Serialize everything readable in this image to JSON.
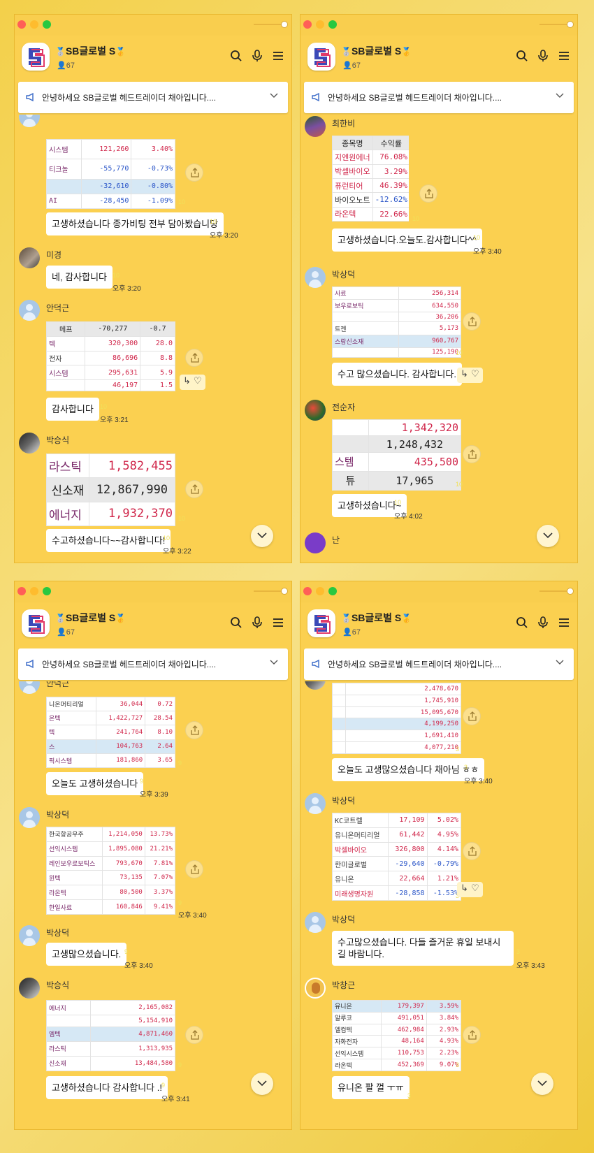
{
  "chat": {
    "title": "SB글로벌 S",
    "medal": "🥈",
    "medal2": "🥇",
    "members": "67",
    "notice": "안녕하세요 SB글로벌 헤드트레이더 채아입니다....",
    "react_reply": "↳",
    "react_heart": "♡"
  },
  "panels": [
    {
      "msgs": {
        "t1": [
          "시스템",
          "121,260",
          "3.40%",
          "티크놀",
          "-55,770",
          "-0.73%",
          "",
          "-32,610",
          "-0.80%",
          "AI",
          "-28,450",
          "-1.09%"
        ],
        "b1": "고생하셨습니다 종가비팅 전부 담아봤습니당",
        "c1": "10",
        "tm1": "오후 3:20",
        "ci1": "10",
        "n2": "미경",
        "b2": "네, 감사합니다",
        "c2": "10",
        "tm2": "오후 3:20",
        "n3": "안덕근",
        "t3": [
          "메프",
          "-70,277",
          "-0.7",
          "텍",
          "320,300",
          "28.0",
          "전자",
          "86,696",
          "8.8",
          "시스템",
          "295,631",
          "5.9",
          "",
          "46,197",
          "1.5"
        ],
        "b3": "감사합니다",
        "c3": "10",
        "tm3": "오후 3:21",
        "n4": "박승식",
        "t4": [
          "라스틱",
          "1,582,455",
          "신소재",
          "12,867,990",
          "에너지",
          "1,932,370"
        ],
        "ci4": "10",
        "b4": "수고하셨습니다~~감사합니다!",
        "c4": "10",
        "tm4": "오후 3:22"
      }
    },
    {
      "msgs": {
        "n1": "최한비",
        "t1h": [
          "종목명",
          "수익률"
        ],
        "t1": [
          "지엔원에너",
          "76.08%",
          "박셀바이오",
          "3.29%",
          "퓨런티어",
          "46.39%",
          "바이오노트",
          "-12.62%",
          "라온텍",
          "22.66%"
        ],
        "ci1": "10",
        "b1": "고생하셨습니다.오늘도.감사합니다^^",
        "c1": "10",
        "tm1": "오후 3:40",
        "n2": "박상덕",
        "t2": [
          "사료",
          "256,314",
          "보우로보틱",
          "634,550",
          "",
          "36,206",
          "트젠",
          "5,173",
          "스람신소재",
          "960,767",
          "",
          "125,190"
        ],
        "ci2": "10",
        "b2": "수고 많으셨습니다. 감사합니다.",
        "n3": "전순자",
        "t3": [
          "",
          "1,342,320",
          "",
          "1,248,432",
          "스템",
          "435,500",
          "튜",
          "17,965"
        ],
        "ci3": "10",
        "b3": "고생하셨습니다~",
        "c3": "10",
        "tm3": "오후 4:02",
        "n4": "난"
      }
    },
    {
      "msgs": {
        "n1": "안덕근",
        "t1": [
          "니온머티리얼",
          "36,044",
          "0.72",
          "온텍",
          "1,422,727",
          "28.54",
          "텍",
          "241,764",
          "8.10",
          "스",
          "104,763",
          "2.64",
          "픽시스템",
          "181,860",
          "3.65"
        ],
        "ci1": "9",
        "b1": "오늘도 고생하셨습니다",
        "c1": "9",
        "tm1": "오후 3:39",
        "n2": "박상덕",
        "t2": [
          "한국항공우주",
          "1,214,050",
          "13.73%",
          "선익시스템",
          "1,895,080",
          "21.21%",
          "레인보우로보틱스",
          "793,670",
          "7.81%",
          "윈텍",
          "73,135",
          "7.07%",
          "라온텍",
          "80,500",
          "3.37%",
          "한일사료",
          "160,846",
          "9.41%"
        ],
        "ci2": "9",
        "tm2": "오후 3:40",
        "n3": "박상덕",
        "b3": "고생많으셨습니다.",
        "c3": "9",
        "tm3": "오후 3:40",
        "n4": "박승식",
        "t4": [
          "에너지",
          "2,165,082",
          "",
          "5,154,910",
          "엠텍",
          "4,871,460",
          "라스틱",
          "1,313,935",
          "신소재",
          "13,484,580"
        ],
        "ci4": "9",
        "b4": "고생하셨습니다 감사합니다 .!",
        "c4": "9",
        "tm4": "오후 3:41"
      }
    },
    {
      "msgs": {
        "t1": [
          "2,478,670",
          "1,745,910",
          "15,095,670",
          "4,199,250",
          "1,691,410",
          "4,077,210"
        ],
        "ci1": "3",
        "b1": "오늘도 고생많으셨습니다 채아님 ㅎㅎ",
        "c1": "3",
        "tm1": "오후 3:40",
        "n2": "박상덕",
        "t2": [
          "KC코트렐",
          "17,109",
          "5.02%",
          "유니온머티리얼",
          "61,442",
          "4.95%",
          "박셀바이오",
          "326,800",
          "4.14%",
          "한미글로벌",
          "-29,640",
          "-0.79%",
          "유니온",
          "22,664",
          "1.21%",
          "미래생명자원",
          "-28,858",
          "-1.53%"
        ],
        "ci2": "3",
        "n3": "박상덕",
        "b3": "수고많으셨습니다. 다들 즐거운 휴일 보내시길 바람니다.",
        "c3": "3",
        "tm3": "오후 3:43",
        "n4": "박창근",
        "t4": [
          "유니온",
          "179,397",
          "3.59%",
          "알루코",
          "491,051",
          "3.84%",
          "엘컴텍",
          "462,984",
          "2.93%",
          "자화전자",
          "48,164",
          "4.93%",
          "선익시스템",
          "110,753",
          "2.23%",
          "라온텍",
          "452,369",
          "9.07%"
        ],
        "ci4": "3",
        "b4": "유니온 팔 껄 ㅜㅠ",
        "c4": "3"
      }
    }
  ]
}
